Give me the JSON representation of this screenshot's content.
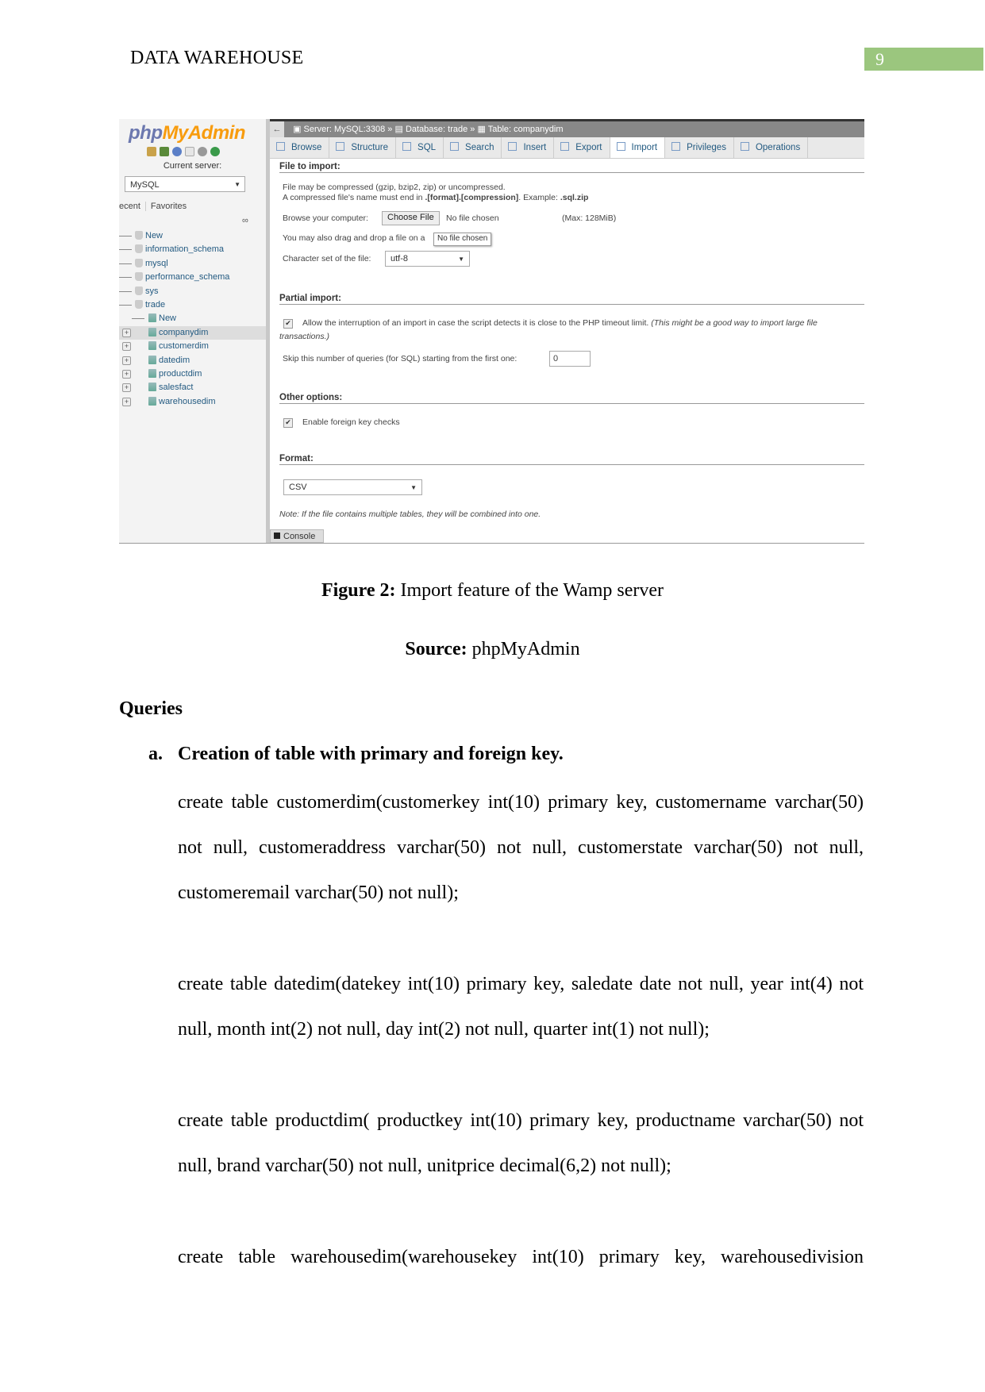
{
  "header": {
    "title": "DATA WAREHOUSE",
    "page_number": "9",
    "page_number_bg": "#9bc67e"
  },
  "screenshot": {
    "sidebar": {
      "logo_php": "php",
      "logo_myadmin": "MyAdmin",
      "icons": [
        "home-icon",
        "logout-icon",
        "help-icon",
        "docs-icon",
        "settings-icon",
        "reload-icon"
      ],
      "current_server_label": "Current server:",
      "server_select": "MySQL",
      "tabs": [
        "ecent",
        "Favorites"
      ],
      "tree": [
        {
          "label": "New",
          "level": 0,
          "type": "new"
        },
        {
          "label": "information_schema",
          "level": 0,
          "type": "db"
        },
        {
          "label": "mysql",
          "level": 0,
          "type": "db"
        },
        {
          "label": "performance_schema",
          "level": 0,
          "type": "db"
        },
        {
          "label": "sys",
          "level": 0,
          "type": "db"
        },
        {
          "label": "trade",
          "level": 0,
          "type": "db"
        },
        {
          "label": "New",
          "level": 1,
          "type": "new"
        },
        {
          "label": "companydim",
          "level": 1,
          "type": "table",
          "selected": true
        },
        {
          "label": "customerdim",
          "level": 1,
          "type": "table"
        },
        {
          "label": "datedim",
          "level": 1,
          "type": "table"
        },
        {
          "label": "productdim",
          "level": 1,
          "type": "table"
        },
        {
          "label": "salesfact",
          "level": 1,
          "type": "table"
        },
        {
          "label": "warehousedim",
          "level": 1,
          "type": "table"
        }
      ]
    },
    "breadcrumb": {
      "back": "←",
      "server": "Server: MySQL:3308",
      "sep": "»",
      "database": "Database: trade",
      "table": "Table: companydim"
    },
    "tabs": [
      {
        "label": "Browse",
        "icon": "browse-icon"
      },
      {
        "label": "Structure",
        "icon": "structure-icon"
      },
      {
        "label": "SQL",
        "icon": "sql-icon"
      },
      {
        "label": "Search",
        "icon": "search-icon"
      },
      {
        "label": "Insert",
        "icon": "insert-icon"
      },
      {
        "label": "Export",
        "icon": "export-icon"
      },
      {
        "label": "Import",
        "icon": "import-icon",
        "active": true
      },
      {
        "label": "Privileges",
        "icon": "privileges-icon"
      },
      {
        "label": "Operations",
        "icon": "operations-icon"
      }
    ],
    "file_to_import": {
      "title": "File to import:",
      "line1": "File may be compressed (gzip, bzip2, zip) or uncompressed.",
      "line2_a": "A compressed file's name must end in ",
      "line2_b": ".[format].[compression]",
      "line2_c": ". Example: ",
      "line2_d": ".sql.zip",
      "browse_label": "Browse your computer:",
      "choose_file": "Choose File",
      "no_file": "No file chosen",
      "max": "(Max: 128MiB)",
      "drag_text": "You may also drag and drop a file on a",
      "tooltip": "No file chosen",
      "charset_label": "Character set of the file:",
      "charset_value": "utf-8"
    },
    "partial_import": {
      "title": "Partial import:",
      "allow_interrupt_checked": true,
      "allow_interrupt": "Allow the interruption of an import in case the script detects it is close to the PHP timeout limit.",
      "allow_interrupt_note": "(This might be a good way to import large file",
      "transactions": "transactions.)",
      "skip_label": "Skip this number of queries (for SQL) starting from the first one:",
      "skip_value": "0"
    },
    "other_options": {
      "title": "Other options:",
      "fk_checked": true,
      "fk_label": "Enable foreign key checks"
    },
    "format": {
      "title": "Format:",
      "value": "CSV",
      "note": "Note: If the file contains multiple tables, they will be combined into one."
    },
    "console": "Console"
  },
  "figure": {
    "caption_bold": "Figure 2:",
    "caption_text": " Import feature of the Wamp server",
    "source_bold": "Source:",
    "source_text": " phpMyAdmin"
  },
  "body": {
    "heading": "Queries",
    "item_label": "a.",
    "item_title": "Creation of table with primary and foreign key.",
    "queries": [
      "create table customerdim(customerkey int(10) primary key, customername varchar(50) not null, customeraddress varchar(50) not null, customerstate varchar(50) not null, customeremail varchar(50) not null);",
      "create table datedim(datekey int(10) primary key, saledate date not null, year int(4) not null, month int(2) not null, day int(2) not null, quarter int(1) not null);",
      "create table productdim( productkey int(10)  primary key, productname varchar(50) not null, brand varchar(50) not null, unitprice decimal(6,2) not null);",
      "create table warehousedim(warehousekey int(10) primary key, warehousedivision"
    ]
  }
}
